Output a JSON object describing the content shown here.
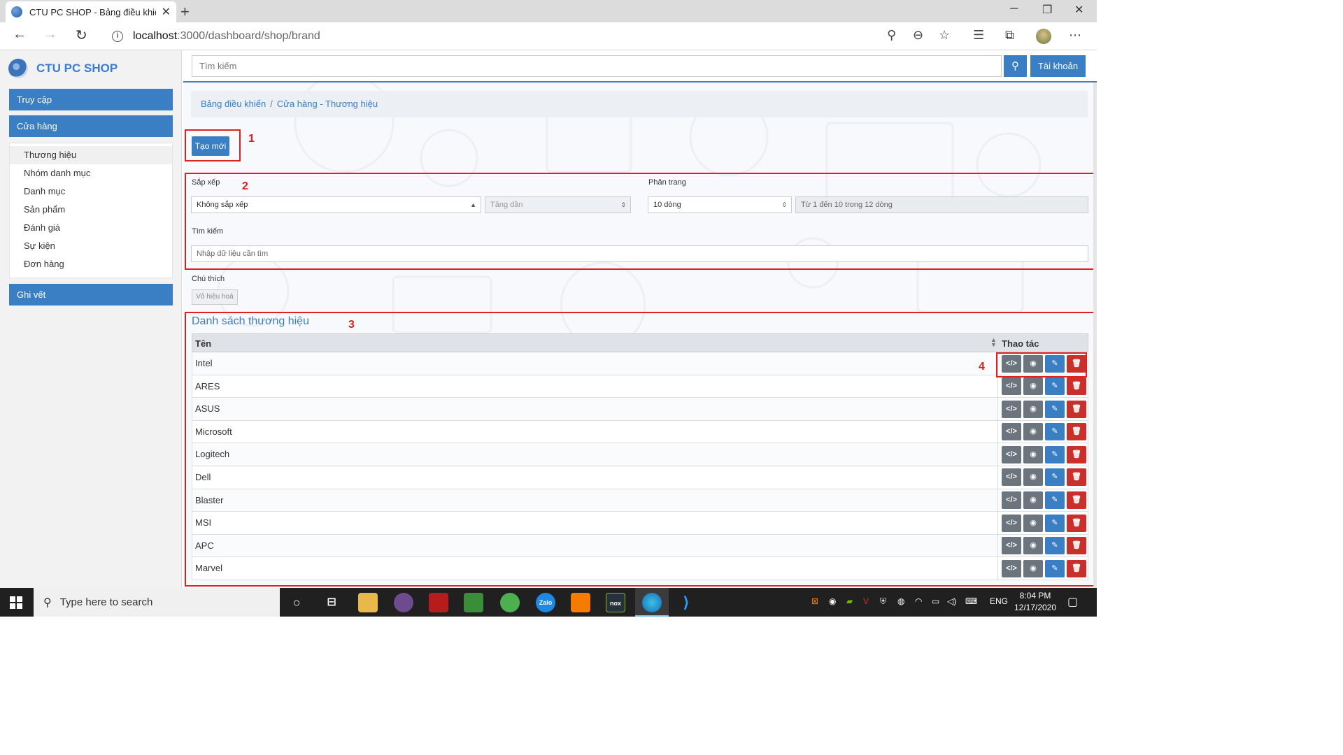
{
  "browser": {
    "tab_title": "CTU PC SHOP - Bảng điều khiển",
    "tab_close": "✕",
    "new_tab": "+",
    "url_host": "localhost",
    "url_path": ":3000/dashboard/shop/brand",
    "info_glyph": "i"
  },
  "sidebar": {
    "brand": "CTU PC SHOP",
    "sections": [
      {
        "label": "Truy cập"
      },
      {
        "label": "Cửa hàng"
      }
    ],
    "submenu": [
      {
        "label": "Thương hiệu"
      },
      {
        "label": "Nhóm danh mục"
      },
      {
        "label": "Danh mục"
      },
      {
        "label": "Sản phẩm"
      },
      {
        "label": "Đánh giá"
      },
      {
        "label": "Sự kiện"
      },
      {
        "label": "Đơn hàng"
      }
    ],
    "log_section": "Ghi vết"
  },
  "topbar": {
    "search_placeholder": "Tìm kiếm",
    "account_label": "Tài khoản"
  },
  "breadcrumb": {
    "home": "Bảng điều khiển",
    "separator": "/",
    "current": "Cửa hàng - Thương hiệu"
  },
  "annotations": [
    "1",
    "2",
    "3",
    "4"
  ],
  "toolbar": {
    "create_label": "Tạo mới"
  },
  "filters": {
    "sort_label": "Sắp xếp",
    "sort_value": "Không sắp xếp",
    "order_value": "Tăng dần",
    "paging_label": "Phân trang",
    "paging_value": "10 dòng",
    "paging_info": "Từ 1 đến 10 trong 12 dòng",
    "search_label": "Tìm kiếm",
    "search_placeholder": "Nhập dữ liệu cần tìm"
  },
  "legend": {
    "label": "Chú thích",
    "disabled_label": "Vô hiệu hoá"
  },
  "table": {
    "title": "Danh sách thương hiệu",
    "col_name": "Tên",
    "col_actions": "Thao tác",
    "rows": [
      "Intel",
      "ARES",
      "ASUS",
      "Microsoft",
      "Logitech",
      "Dell",
      "Blaster",
      "MSI",
      "APC",
      "Marvel"
    ]
  },
  "taskbar": {
    "search_text": "Type here to search",
    "lang": "ENG",
    "time": "8:04 PM",
    "date": "12/17/2020"
  },
  "colors": {
    "primary": "#3a7ec4",
    "danger": "#c9302c",
    "annotation": "#e02020"
  }
}
